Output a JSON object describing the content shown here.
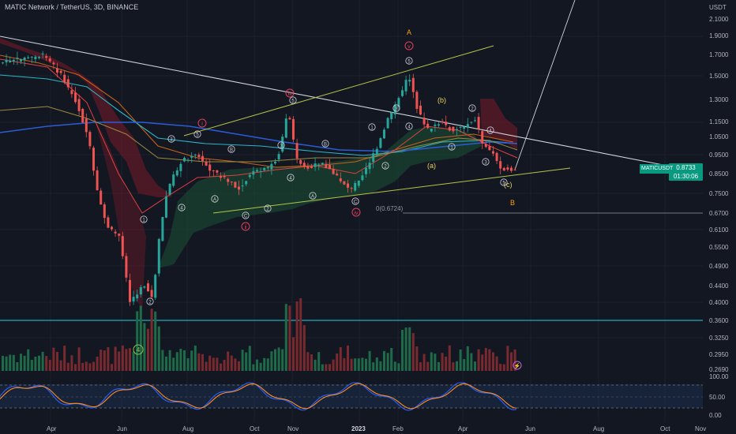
{
  "header": {
    "title": "MATIC Network / TetherUS, 3D, BINANCE"
  },
  "price_axis": {
    "unit": "USDT",
    "ticks": [
      "2.1000",
      "1.9000",
      "1.7000",
      "1.5000",
      "1.3000",
      "1.1500",
      "1.0500",
      "0.9500",
      "0.8500",
      "0.7500",
      "0.6700",
      "0.6100",
      "0.5500",
      "0.4900",
      "0.4400",
      "0.4000",
      "0.3600",
      "0.3250",
      "0.2950",
      "0.2690"
    ]
  },
  "osc_axis": {
    "ticks": [
      "100.00",
      "50.00",
      "0.00"
    ]
  },
  "time_axis": {
    "labels": [
      "Apr",
      "Jun",
      "Aug",
      "Oct",
      "Nov",
      "2023",
      "Feb",
      "Apr",
      "Jun",
      "Aug",
      "Oct",
      "Nov"
    ]
  },
  "last_price": {
    "symbol": "MATICUSDT",
    "value": "0.8733",
    "countdown": "01:30:06"
  },
  "fib_label": "0(0.6724)",
  "wave_labels": {
    "A": "A",
    "B": "B",
    "a": "(a)",
    "b": "(b)",
    "c": "(c)",
    "ii": "ii",
    "iii": "iii",
    "iv": "iv",
    "v": "v",
    "i": "i",
    "four": "4"
  },
  "colors": {
    "background": "#131722",
    "up": "#26a69a",
    "down": "#ef5350",
    "ichimoku_red": "#8b1c2a",
    "ichimoku_green": "#1d4d33",
    "trendline": "#d1d4dc",
    "channel": "#b5c44a",
    "accent_orange": "#f7a21b"
  }
}
